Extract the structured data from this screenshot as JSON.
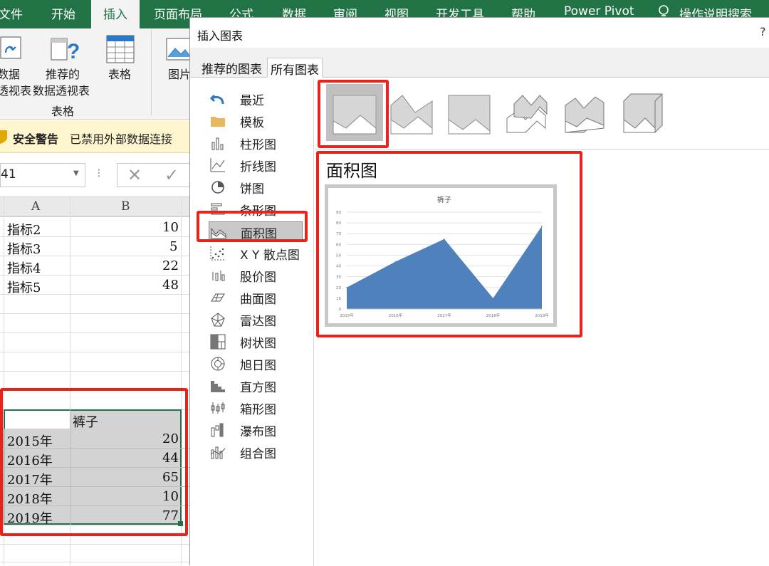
{
  "ribbon": {
    "tabs": [
      "文件",
      "开始",
      "插入",
      "页面布局",
      "公式",
      "数据",
      "审阅",
      "视图",
      "开发工具",
      "帮助",
      "Power Pivot",
      "操作说明搜索"
    ],
    "active_tab": "插入",
    "buttons": {
      "pivot_line1": "数据",
      "pivot_line2": "透视表",
      "recommended_line1": "推荐的",
      "recommended_line2": "数据透视表",
      "table": "表格",
      "pictures": "图片"
    },
    "group_label": "表格"
  },
  "security": {
    "title": "安全警告",
    "message": "已禁用外部数据连接"
  },
  "formula_bar": {
    "name_box": "41",
    "cancel_icon": "close-icon",
    "enter_icon": "check-icon"
  },
  "sheet": {
    "col_headers": [
      "A",
      "B"
    ],
    "top_rows": [
      {
        "a": "指标2",
        "b": "10"
      },
      {
        "a": "指标3",
        "b": "5"
      },
      {
        "a": "指标4",
        "b": "22"
      },
      {
        "a": "指标5",
        "b": "48"
      }
    ],
    "table_header": {
      "a": "",
      "b": "裤子"
    },
    "table_rows": [
      {
        "a": "2015年",
        "b": "20"
      },
      {
        "a": "2016年",
        "b": "44"
      },
      {
        "a": "2017年",
        "b": "65"
      },
      {
        "a": "2018年",
        "b": "10"
      },
      {
        "a": "2019年",
        "b": "77"
      }
    ]
  },
  "dialog": {
    "title": "插入图表",
    "close_glyph": "?",
    "tabs": [
      "推荐的图表",
      "所有图表"
    ],
    "active_tab": "所有图表",
    "categories": [
      "最近",
      "模板",
      "柱形图",
      "折线图",
      "饼图",
      "条形图",
      "面积图",
      "X Y 散点图",
      "股价图",
      "曲面图",
      "雷达图",
      "树状图",
      "旭日图",
      "直方图",
      "箱形图",
      "瀑布图",
      "组合图"
    ],
    "selected_category": "面积图",
    "subtype_count_label": "",
    "preview_title": "面积图"
  },
  "chart_data": {
    "type": "area",
    "title": "裤子",
    "categories": [
      "2015年",
      "2016年",
      "2017年",
      "2018年",
      "2019年"
    ],
    "values": [
      20,
      44,
      65,
      10,
      77
    ],
    "ylim": [
      0,
      90
    ],
    "yticks": [
      "0",
      "10",
      "20",
      "30",
      "40",
      "50",
      "60",
      "70",
      "80",
      "90"
    ],
    "grid": true,
    "color": "#4f81bd"
  },
  "colors": {
    "excel_green": "#217346",
    "highlight_red": "#e8231b",
    "selection_grey": "#c8c8c8"
  }
}
